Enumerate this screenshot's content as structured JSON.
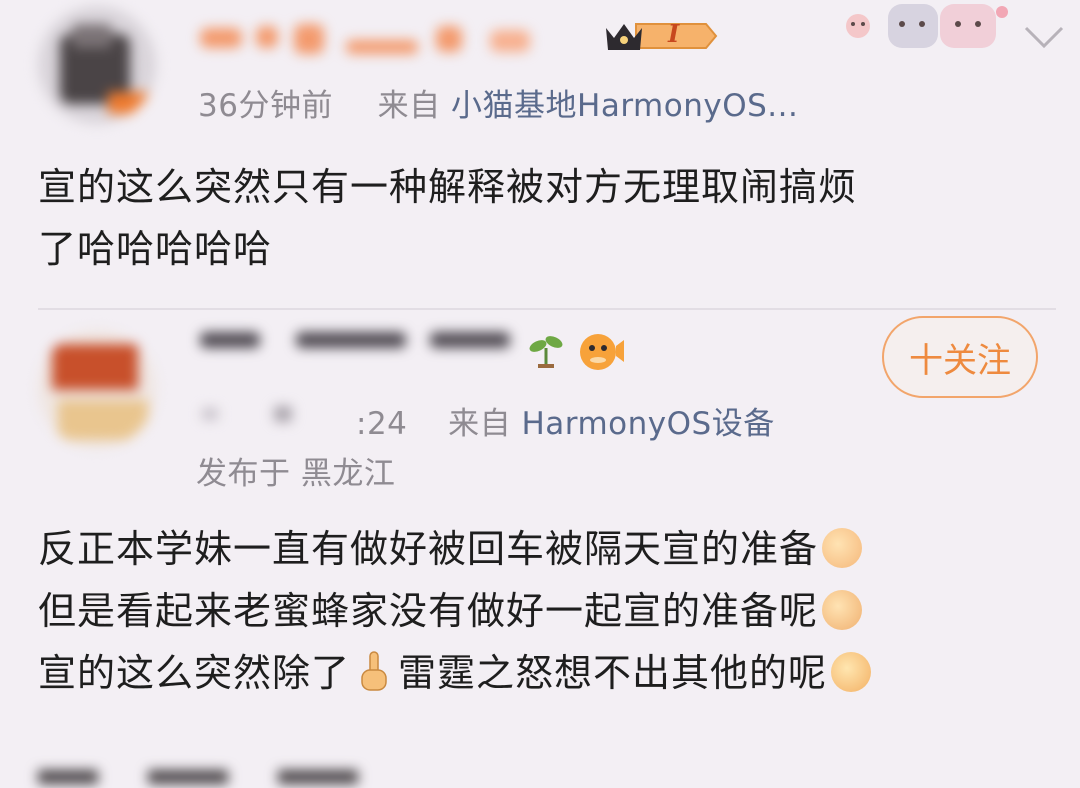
{
  "comment1": {
    "time": "36分钟前",
    "source_prefix": "来自",
    "source": "小猫基地HarmonyOS...",
    "badge_level": "I",
    "text_line1": "宣的这么突然只有一种解释被对方无理取闹搞烦",
    "text_line2": "了哈哈哈哈哈"
  },
  "comment2": {
    "time": ":24",
    "source_prefix": "来自",
    "source": "HarmonyOS设备",
    "location": "发布于 黑龙江",
    "follow_label": "十关注",
    "text_line1": "反正本学妹一直有做好被回车被隔天宣的准备",
    "text_line2": "但是看起来老蜜蜂家没有做好一起宣的准备呢",
    "text_line3a": "宣的这么突然除了",
    "text_line3b": "雷霆之怒想不出其他的呢"
  },
  "colors": {
    "background": "#f3eff4",
    "follow_accent": "#ee8a3f",
    "source_link": "#5a6a8c",
    "meta_gray": "#8f8b92"
  },
  "icons": [
    "chevron-down-icon",
    "crown-badge-icon",
    "sprout-icon",
    "pufferfish-icon"
  ]
}
